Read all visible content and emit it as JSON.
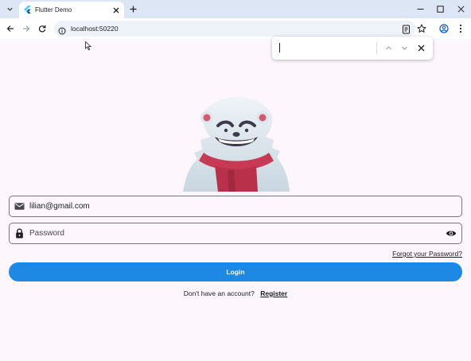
{
  "browser": {
    "tab_title": "Flutter Demo",
    "url": "localhost:50220"
  },
  "find_bar": {
    "query": ""
  },
  "form": {
    "email_value": "lilian@gmail.com",
    "password_placeholder": "Password",
    "forgot_password": "Forgot your Password?",
    "login_label": "Login",
    "no_account_text": "Don't have an account?",
    "register_label": "Register"
  },
  "colors": {
    "page_background": "#fdf7fd",
    "primary_button": "#1e88e5",
    "field_border": "#79747e"
  },
  "icons": {
    "email_field": "mail-icon",
    "password_field": "lock-icon",
    "password_toggle": "eye-icon"
  }
}
